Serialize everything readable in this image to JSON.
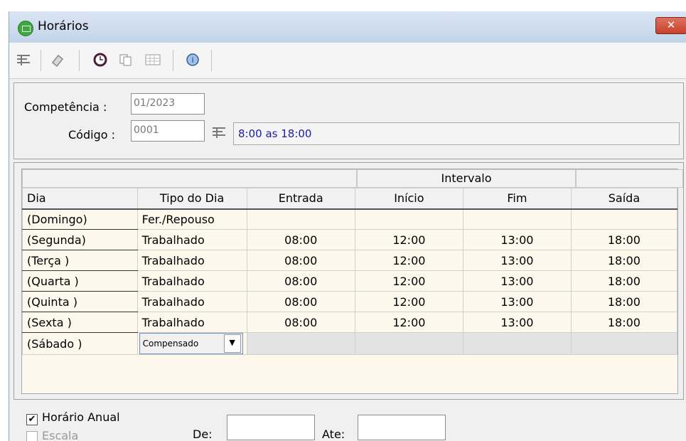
{
  "window": {
    "title": "Horários",
    "close_label": "✕"
  },
  "toolbar": {
    "icons": [
      "list-icon",
      "eraser-icon",
      "clock-icon",
      "copy-icon",
      "calendar-table-icon",
      "help-icon"
    ]
  },
  "form": {
    "competencia_label": "Competência :",
    "competencia_value": "01/2023",
    "codigo_label": "Código :",
    "codigo_value": "0001",
    "descricao": "8:00 as 18:00"
  },
  "grid": {
    "group_header": "Intervalo",
    "columns": [
      "Dia",
      "Tipo do Dia",
      "Entrada",
      "Início",
      "Fim",
      "Saída"
    ],
    "rows": [
      {
        "dia": "(Domingo)",
        "tipo": "Fer./Repouso",
        "entrada": "",
        "inicio": "",
        "fim": "",
        "saida": ""
      },
      {
        "dia": "(Segunda)",
        "tipo": "Trabalhado",
        "entrada": "08:00",
        "inicio": "12:00",
        "fim": "13:00",
        "saida": "18:00"
      },
      {
        "dia": "(Terça  )",
        "tipo": "Trabalhado",
        "entrada": "08:00",
        "inicio": "12:00",
        "fim": "13:00",
        "saida": "18:00"
      },
      {
        "dia": "(Quarta )",
        "tipo": "Trabalhado",
        "entrada": "08:00",
        "inicio": "12:00",
        "fim": "13:00",
        "saida": "18:00"
      },
      {
        "dia": "(Quinta )",
        "tipo": "Trabalhado",
        "entrada": "08:00",
        "inicio": "12:00",
        "fim": "13:00",
        "saida": "18:00"
      },
      {
        "dia": "(Sexta  )",
        "tipo": "Trabalhado",
        "entrada": "08:00",
        "inicio": "12:00",
        "fim": "13:00",
        "saida": "18:00"
      },
      {
        "dia": "(Sábado )",
        "tipo": "Compensado",
        "entrada": "",
        "inicio": "",
        "fim": "",
        "saida": ""
      }
    ]
  },
  "bottom": {
    "horario_anual_label": "Horário Anual",
    "horario_anual_checked": "✔",
    "escala_label": "Escala",
    "de_label": "De:",
    "ate_label": "Ate:"
  },
  "colors": {
    "accent": "#1c1ca8",
    "grid_bg": "#fdf7ec",
    "close": "#c8412e"
  }
}
